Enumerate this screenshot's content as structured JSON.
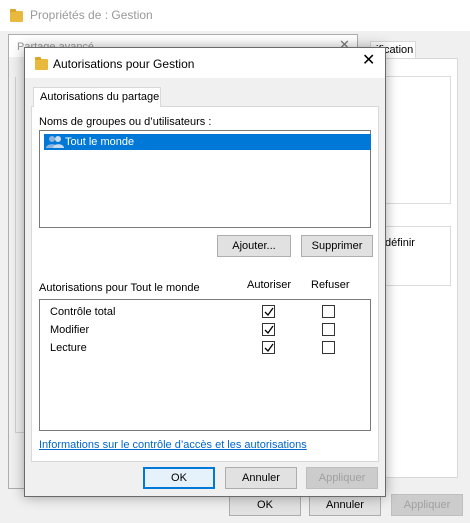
{
  "back_window": {
    "title": "Propriétés de : Gestion",
    "tab_partial": "ification",
    "definir_text": "définir",
    "buttons": {
      "ok": "OK",
      "cancel": "Annuler",
      "apply": "Appliquer"
    }
  },
  "mid_window": {
    "title": "Partage avancé"
  },
  "dialog": {
    "title": "Autorisations pour Gestion",
    "close_glyph": "✕",
    "tab_label": "Autorisations du partage",
    "groups_label": "Noms de groupes ou d’utilisateurs :",
    "groups": [
      {
        "name": "Tout le monde",
        "icon": "users-group-icon",
        "selected": true
      }
    ],
    "add_button": "Ajouter...",
    "remove_button": "Supprimer",
    "permissions_header": "Autorisations pour Tout le monde",
    "column_allow": "Autoriser",
    "column_deny": "Refuser",
    "permissions": [
      {
        "name": "Contrôle total",
        "allow": true,
        "deny": false
      },
      {
        "name": "Modifier",
        "allow": true,
        "deny": false
      },
      {
        "name": "Lecture",
        "allow": true,
        "deny": false
      }
    ],
    "info_link": "Informations sur le contrôle d’accès et les autorisations",
    "buttons": {
      "ok": "OK",
      "cancel": "Annuler",
      "apply": "Appliquer"
    }
  },
  "colors": {
    "selection": "#0078d7",
    "link": "#0066cc",
    "folder": "#e8b93c"
  }
}
